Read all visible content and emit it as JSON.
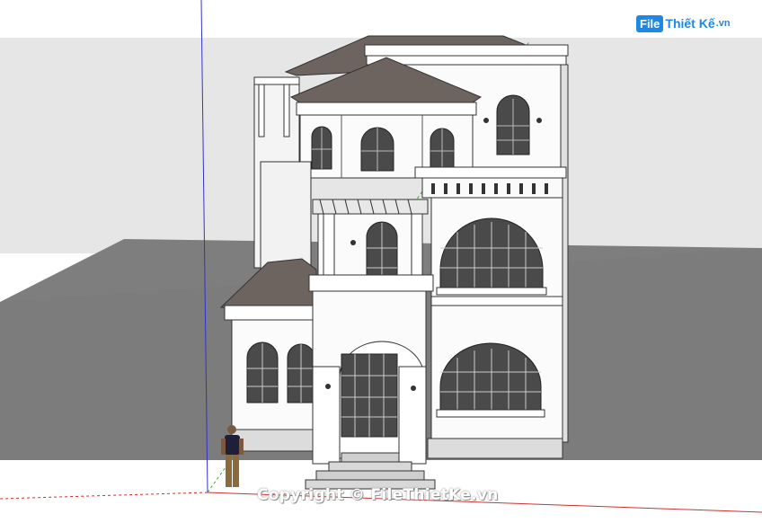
{
  "logo": {
    "mark": "File",
    "name": "Thiết Kế",
    "tld": ".vn"
  },
  "watermark": "Copyright © FileThietKe.vn",
  "colors": {
    "sky": "#e8e8e8",
    "ground": "#7e7e7e",
    "roof": "#6d6460",
    "wall": "#fbfbfb",
    "window": "#4a4a4a",
    "axis_blue": "#3333cc",
    "axis_red": "#cc3333",
    "axis_green": "#33aa33",
    "brand": "#1e88e5"
  }
}
